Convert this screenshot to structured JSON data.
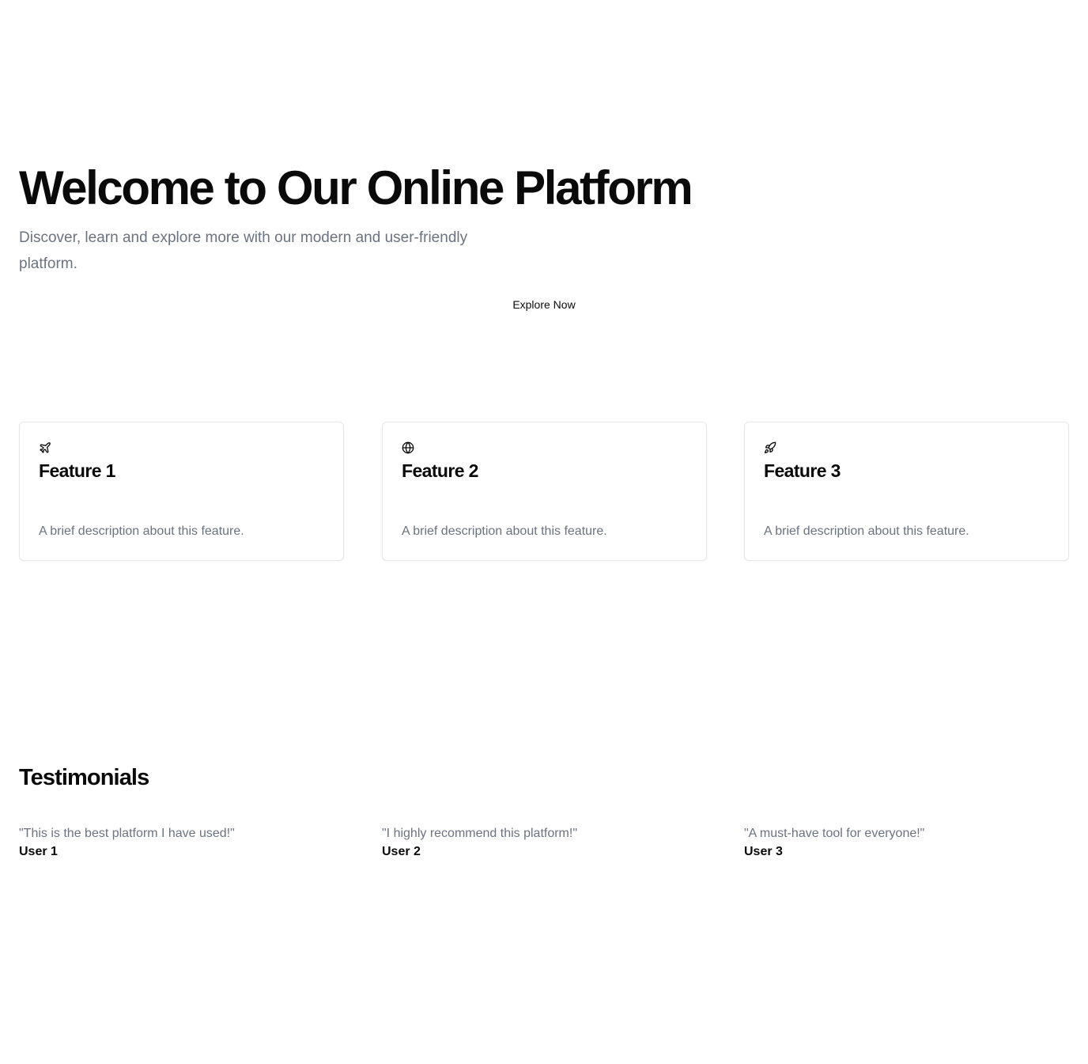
{
  "hero": {
    "title": "Welcome to Our Online Platform",
    "subtitle": "Discover, learn and explore more with our modern and user-friendly platform.",
    "cta_label": "Explore Now"
  },
  "features": [
    {
      "icon": "plane-icon",
      "title": "Feature 1",
      "description": "A brief description about this feature."
    },
    {
      "icon": "globe-icon",
      "title": "Feature 2",
      "description": "A brief description about this feature."
    },
    {
      "icon": "rocket-icon",
      "title": "Feature 3",
      "description": "A brief description about this feature."
    }
  ],
  "testimonials": {
    "title": "Testimonials",
    "items": [
      {
        "quote": "\"This is the best platform I have used!\"",
        "author": "User 1"
      },
      {
        "quote": "\"I highly recommend this platform!\"",
        "author": "User 2"
      },
      {
        "quote": "\"A must-have tool for everyone!\"",
        "author": "User 3"
      }
    ]
  },
  "colors": {
    "text": "#0a0a0a",
    "muted": "#6b7280",
    "border": "#e5e7eb",
    "background": "#ffffff"
  }
}
